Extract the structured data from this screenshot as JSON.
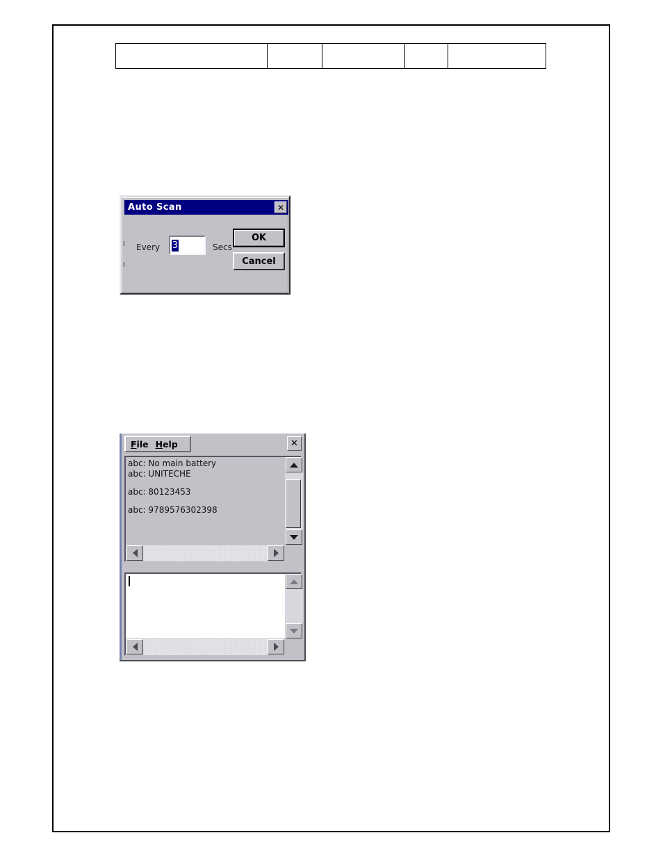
{
  "document": {
    "table": {
      "rows": [
        {
          "cells": [
            "",
            "",
            "",
            "",
            ""
          ]
        }
      ]
    }
  },
  "auto_scan_dialog": {
    "title": "Auto Scan",
    "close_label": "✕",
    "every_label": "Every",
    "interval_value": "3",
    "secs_label": "Secs",
    "ok_label": "OK",
    "cancel_label": "Cancel",
    "titlebar_color": "#000080",
    "face_color": "#c3c0c7",
    "selection_color": "#000080"
  },
  "scan_window": {
    "menu": [
      {
        "mnemonic": "F",
        "rest": "ile"
      },
      {
        "mnemonic": "H",
        "rest": "elp"
      }
    ],
    "close_label": "✕",
    "output_lines": [
      {
        "text": "abc: No main battery",
        "gap_after": false
      },
      {
        "text": "abc: UNITECHE",
        "gap_after": true
      },
      {
        "text": "abc: 80123453",
        "gap_after": true
      },
      {
        "text": "abc: 9789576302398",
        "gap_after": false
      }
    ],
    "input_value": "",
    "input_placeholder": "",
    "scrollbar": {
      "up_arrow": "scroll-up-arrow",
      "down_arrow": "scroll-down-arrow",
      "left_arrow": "scroll-left-arrow",
      "right_arrow": "scroll-right-arrow"
    }
  }
}
